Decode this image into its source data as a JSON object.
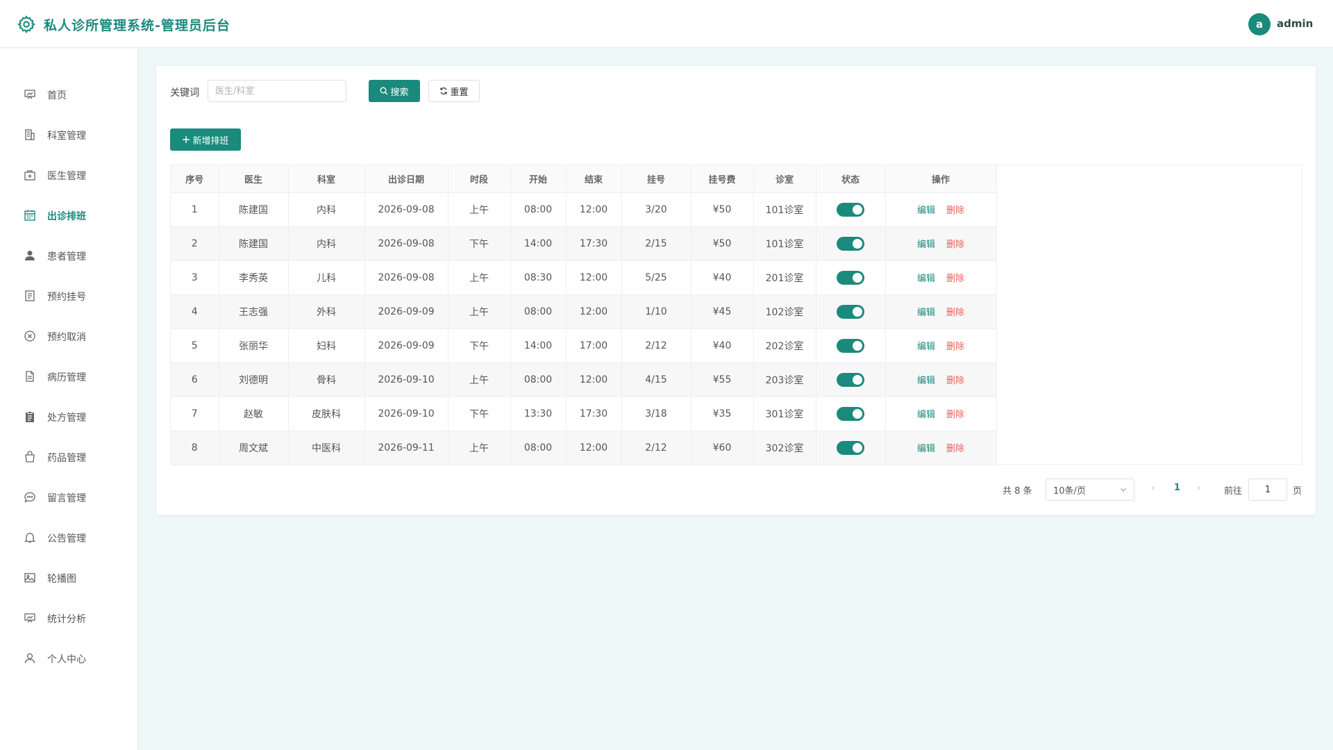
{
  "header": {
    "title": "私人诊所管理系统-管理员后台",
    "avatar_letter": "a",
    "username": "admin",
    "accent_color": "#1a8a7c"
  },
  "sidebar": {
    "items": [
      {
        "label": "首页",
        "icon": "dashboard-icon"
      },
      {
        "label": "科室管理",
        "icon": "building-icon"
      },
      {
        "label": "医生管理",
        "icon": "medical-kit-icon"
      },
      {
        "label": "出诊排班",
        "icon": "calendar-icon",
        "active": true
      },
      {
        "label": "患者管理",
        "icon": "user-icon"
      },
      {
        "label": "预约挂号",
        "icon": "document-icon"
      },
      {
        "label": "预约取消",
        "icon": "cancel-circle-icon"
      },
      {
        "label": "病历管理",
        "icon": "file-icon"
      },
      {
        "label": "处方管理",
        "icon": "clipboard-icon"
      },
      {
        "label": "药品管理",
        "icon": "bag-icon"
      },
      {
        "label": "留言管理",
        "icon": "chat-icon"
      },
      {
        "label": "公告管理",
        "icon": "bell-icon"
      },
      {
        "label": "轮播图",
        "icon": "image-icon"
      },
      {
        "label": "统计分析",
        "icon": "chart-icon"
      },
      {
        "label": "个人中心",
        "icon": "person-icon"
      }
    ]
  },
  "search": {
    "label": "关键词",
    "value": "",
    "placeholder": "医生/科室",
    "search_button": "搜索",
    "reset_button": "重置"
  },
  "toolbar": {
    "add_button": "新增排班"
  },
  "table": {
    "columns": [
      "序号",
      "医生",
      "科室",
      "出诊日期",
      "时段",
      "开始",
      "结束",
      "挂号",
      "挂号费",
      "诊室",
      "状态",
      "操作"
    ],
    "edit_label": "编辑",
    "delete_label": "删除",
    "rows": [
      {
        "no": "1",
        "doctor": "陈建国",
        "dept": "内科",
        "date": "2026-09-08",
        "period": "上午",
        "start": "08:00",
        "end": "12:00",
        "reg": "3/20",
        "fee": "¥50",
        "room": "101诊室",
        "status": true
      },
      {
        "no": "2",
        "doctor": "陈建国",
        "dept": "内科",
        "date": "2026-09-08",
        "period": "下午",
        "start": "14:00",
        "end": "17:30",
        "reg": "2/15",
        "fee": "¥50",
        "room": "101诊室",
        "status": true
      },
      {
        "no": "3",
        "doctor": "李秀英",
        "dept": "儿科",
        "date": "2026-09-08",
        "period": "上午",
        "start": "08:30",
        "end": "12:00",
        "reg": "5/25",
        "fee": "¥40",
        "room": "201诊室",
        "status": true
      },
      {
        "no": "4",
        "doctor": "王志强",
        "dept": "外科",
        "date": "2026-09-09",
        "period": "上午",
        "start": "08:00",
        "end": "12:00",
        "reg": "1/10",
        "fee": "¥45",
        "room": "102诊室",
        "status": true
      },
      {
        "no": "5",
        "doctor": "张丽华",
        "dept": "妇科",
        "date": "2026-09-09",
        "period": "下午",
        "start": "14:00",
        "end": "17:00",
        "reg": "2/12",
        "fee": "¥40",
        "room": "202诊室",
        "status": true
      },
      {
        "no": "6",
        "doctor": "刘德明",
        "dept": "骨科",
        "date": "2026-09-10",
        "period": "上午",
        "start": "08:00",
        "end": "12:00",
        "reg": "4/15",
        "fee": "¥55",
        "room": "203诊室",
        "status": true
      },
      {
        "no": "7",
        "doctor": "赵敏",
        "dept": "皮肤科",
        "date": "2026-09-10",
        "period": "下午",
        "start": "13:30",
        "end": "17:30",
        "reg": "3/18",
        "fee": "¥35",
        "room": "301诊室",
        "status": true
      },
      {
        "no": "8",
        "doctor": "周文斌",
        "dept": "中医科",
        "date": "2026-09-11",
        "period": "上午",
        "start": "08:00",
        "end": "12:00",
        "reg": "2/12",
        "fee": "¥60",
        "room": "302诊室",
        "status": true
      }
    ]
  },
  "pagination": {
    "total_text": "共 8 条",
    "page_size": "10条/页",
    "current_page": "1",
    "goto_label": "前往",
    "goto_value": "1",
    "page_suffix": "页"
  }
}
